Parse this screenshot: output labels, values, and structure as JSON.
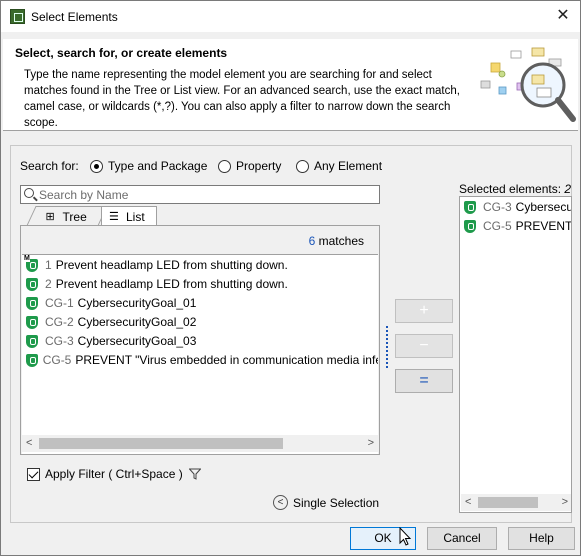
{
  "window": {
    "title": "Select Elements",
    "close_glyph": "✕"
  },
  "header": {
    "title": "Select, search for, or create elements",
    "description": "Type the name representing the model element you are searching for and select matches found in the Tree or List view. For an advanced search, use the exact match, camel case, or wildcards (*,?). You can also apply a filter to narrow down the search scope."
  },
  "search": {
    "search_for_label": "Search for:",
    "options": [
      "Type and Package",
      "Property",
      "Any Element"
    ],
    "selected_option": "Type and Package",
    "placeholder": "Search by Name",
    "value": ""
  },
  "tabs": {
    "tree": "Tree",
    "list": "List",
    "active": "List"
  },
  "results": {
    "count": "6",
    "count_suffix": "matches",
    "items": [
      {
        "id": "1",
        "name": "Prevent headlamp LED from shutting down.",
        "icon": "requirement-shield-icon",
        "badge": "M"
      },
      {
        "id": "2",
        "name": "Prevent headlamp LED from shutting down.",
        "icon": "requirement-shield-icon"
      },
      {
        "id": "CG-1",
        "name": "CybersecurityGoal_01",
        "icon": "cybersecurity-goal-icon"
      },
      {
        "id": "CG-2",
        "name": "CybersecurityGoal_02",
        "icon": "cybersecurity-goal-icon"
      },
      {
        "id": "CG-3",
        "name": "CybersecurityGoal_03",
        "icon": "cybersecurity-goal-icon"
      },
      {
        "id": "CG-5",
        "name": "PREVENT \"Virus embedded in communication media infe",
        "icon": "cybersecurity-goal-icon"
      }
    ]
  },
  "transfer_buttons": {
    "add": "+",
    "remove": "−",
    "remove_all": "="
  },
  "selected": {
    "label": "Selected elements:",
    "count": "2",
    "items": [
      {
        "id": "CG-3",
        "name": "Cybersecu",
        "icon": "cybersecurity-goal-icon"
      },
      {
        "id": "CG-5",
        "name": "PREVENT \"",
        "icon": "cybersecurity-goal-icon"
      }
    ]
  },
  "filter": {
    "label": "Apply Filter ( Ctrl+Space )",
    "checked": true
  },
  "single_selection": {
    "label": "Single Selection"
  },
  "buttons": {
    "ok": "OK",
    "cancel": "Cancel",
    "help": "Help"
  },
  "colors": {
    "accent": "#1a55b8",
    "goal_green": "#1e9a4b",
    "ok_border": "#0078d7"
  }
}
